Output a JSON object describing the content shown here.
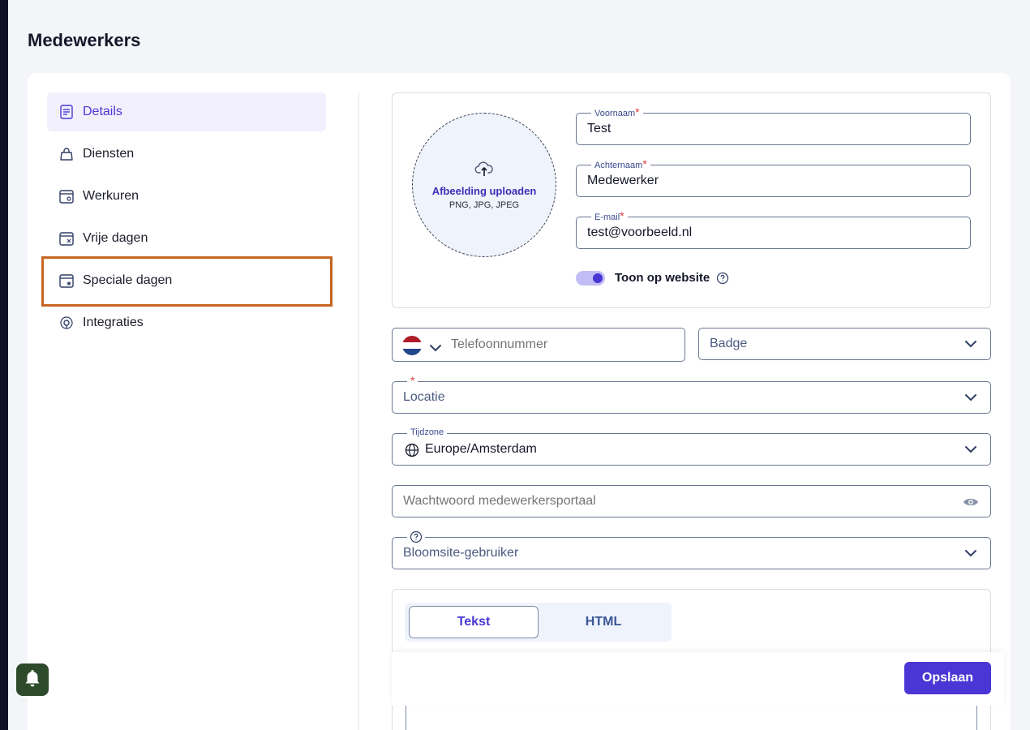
{
  "page": {
    "title": "Medewerkers"
  },
  "sidebar": {
    "items": [
      {
        "label": "Details",
        "icon": "document-icon",
        "active": true
      },
      {
        "label": "Diensten",
        "icon": "bag-icon"
      },
      {
        "label": "Werkuren",
        "icon": "calendar-clock-icon"
      },
      {
        "label": "Vrije dagen",
        "icon": "calendar-x-icon"
      },
      {
        "label": "Speciale dagen",
        "icon": "calendar-star-icon",
        "highlighted": true
      },
      {
        "label": "Integraties",
        "icon": "integration-icon"
      }
    ]
  },
  "upload": {
    "title": "Afbeelding uploaden",
    "formats": "PNG, JPG, JPEG"
  },
  "form": {
    "first_name": {
      "label": "Voornaam",
      "value": "Test",
      "required": "*"
    },
    "last_name": {
      "label": "Achternaam",
      "value": "Medewerker",
      "required": "*"
    },
    "email": {
      "label": "E-mail",
      "value": "test@voorbeeld.nl",
      "required": "*"
    },
    "show_on_website": {
      "label": "Toon op website",
      "enabled": true
    },
    "phone": {
      "placeholder": "Telefoonnummer",
      "country_flag": "NL"
    },
    "badge": {
      "placeholder": "Badge"
    },
    "location": {
      "placeholder": "Locatie",
      "required": "*"
    },
    "timezone": {
      "label": "Tijdzone",
      "value": "Europe/Amsterdam"
    },
    "password": {
      "placeholder": "Wachtwoord medewerkersportaal"
    },
    "bloomsite_user": {
      "placeholder": "Bloomsite-gebruiker"
    }
  },
  "editor": {
    "tabs": [
      "Tekst",
      "HTML"
    ],
    "active_tab": "Tekst"
  },
  "actions": {
    "save_label": "Opslaan"
  },
  "colors": {
    "accent": "#4a36d4",
    "highlight_border": "#c7651f",
    "required": "#e23b3b"
  }
}
